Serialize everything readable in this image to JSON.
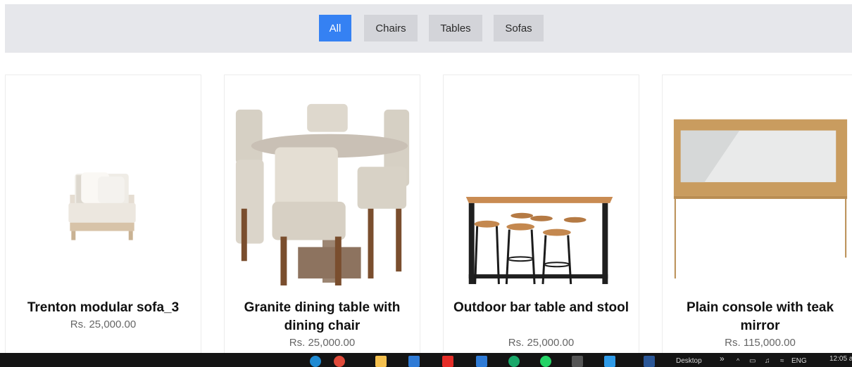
{
  "filters": [
    {
      "label": "All",
      "active": true
    },
    {
      "label": "Chairs",
      "active": false
    },
    {
      "label": "Tables",
      "active": false
    },
    {
      "label": "Sofas",
      "active": false
    }
  ],
  "products": [
    {
      "title": "Trenton modular sofa_3",
      "price": "Rs. 25,000.00"
    },
    {
      "title": "Granite dining table with dining chair",
      "price": "Rs. 25,000.00"
    },
    {
      "title": "Outdoor bar table and stool",
      "price": "Rs. 25,000.00"
    },
    {
      "title": "Plain console with teak mirror",
      "price": "Rs. 115,000.00"
    }
  ],
  "taskbar": {
    "desktop_label": "Desktop",
    "chevron": "»",
    "language": "ENG",
    "time": "12:05 a",
    "colors": {
      "edge": "#1f8ad2",
      "chrome": "#e04a3a",
      "explorer": "#f4c04e",
      "store": "#2f7bd6",
      "youtube": "#e52d27",
      "mail": "#2f7bd6",
      "git": "#1aa86a",
      "whatsapp": "#25d366",
      "terminal": "#555555",
      "vscode": "#2f9be8",
      "word": "#2b5797"
    }
  }
}
